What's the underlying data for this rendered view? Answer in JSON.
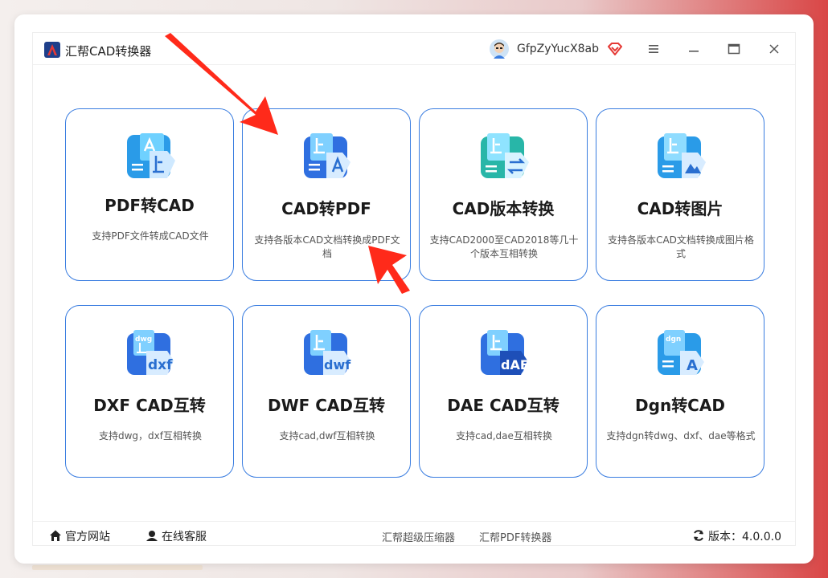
{
  "app": {
    "title": "汇帮CAD转换器",
    "username": "GfpZyYucX8ab"
  },
  "colors": {
    "accent": "#3a7de0",
    "logo_red": "#e53935",
    "arrow_red": "#ff2a1a"
  },
  "icons": {
    "menu": "menu-icon",
    "minimize": "minimize-icon",
    "maximize": "maximize-icon",
    "close": "close-icon"
  },
  "tools": [
    {
      "title": "PDF转CAD",
      "desc": "支持PDF文件转成CAD文件",
      "icon": "pdf-to-cad-icon",
      "badge": ""
    },
    {
      "title": "CAD转PDF",
      "desc": "支持各版本CAD文档转换成PDF文档",
      "icon": "cad-to-pdf-icon",
      "badge": ""
    },
    {
      "title": "CAD版本转换",
      "desc": "支持CAD2000至CAD2018等几十个版本互相转换",
      "icon": "cad-version-icon",
      "badge": ""
    },
    {
      "title": "CAD转图片",
      "desc": "支持各版本CAD文档转换成图片格式",
      "icon": "cad-to-image-icon",
      "badge": ""
    },
    {
      "title": "DXF CAD互转",
      "desc": "支持dwg，dxf互相转换",
      "icon": "dxf-icon",
      "badge": "dxf",
      "tag": "dwg"
    },
    {
      "title": "DWF CAD互转",
      "desc": "支持cad,dwf互相转换",
      "icon": "dwf-icon",
      "badge": "dwf"
    },
    {
      "title": "DAE CAD互转",
      "desc": "支持cad,dae互相转换",
      "icon": "dae-icon",
      "badge": "dAE"
    },
    {
      "title": "Dgn转CAD",
      "desc": "支持dgn转dwg、dxf、dae等格式",
      "icon": "dgn-icon",
      "badge": "A",
      "tag": "dgn"
    }
  ],
  "footer": {
    "website": "官方网站",
    "service": "在线客服",
    "link1": "汇帮超级压缩器",
    "link2": "汇帮PDF转换器",
    "version": "版本：4.0.0.0"
  }
}
